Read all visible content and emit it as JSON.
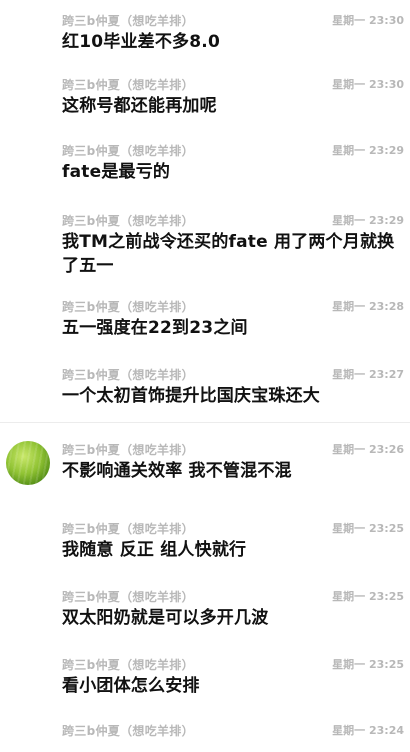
{
  "messages": [
    {
      "sender": "跨三b仲夏（想吃羊排）",
      "time": "星期一 23:30",
      "text": "红10毕业差不多8.0"
    },
    {
      "sender": "跨三b仲夏（想吃羊排）",
      "time": "星期一 23:30",
      "text": "这称号都还能再加呢"
    },
    {
      "sender": "跨三b仲夏（想吃羊排）",
      "time": "星期一 23:29",
      "text": "fate是最亏的"
    },
    {
      "sender": "跨三b仲夏（想吃羊排）",
      "time": "星期一 23:29",
      "text": "我TM之前战令还买的fate 用了两个月就换了五一"
    },
    {
      "sender": "跨三b仲夏（想吃羊排）",
      "time": "星期一 23:28",
      "text": "五一强度在22到23之间"
    },
    {
      "sender": "跨三b仲夏（想吃羊排）",
      "time": "星期一 23:27",
      "text": "一个太初首饰提升比国庆宝珠还大"
    },
    {
      "sender": "跨三b仲夏（想吃羊排）",
      "time": "星期一 23:26",
      "text": "不影响通关效率 我不管混不混",
      "avatar": true
    },
    {
      "sender": "跨三b仲夏（想吃羊排）",
      "time": "星期一 23:25",
      "text": "我随意 反正 组人快就行"
    },
    {
      "sender": "跨三b仲夏（想吃羊排）",
      "time": "星期一 23:25",
      "text": "双太阳奶就是可以多开几波"
    },
    {
      "sender": "跨三b仲夏（想吃羊排）",
      "time": "星期一 23:25",
      "text": "看小团体怎么安排"
    },
    {
      "sender": "跨三b仲夏（想吃羊排）",
      "time": "星期一 23:24",
      "text": ""
    }
  ]
}
